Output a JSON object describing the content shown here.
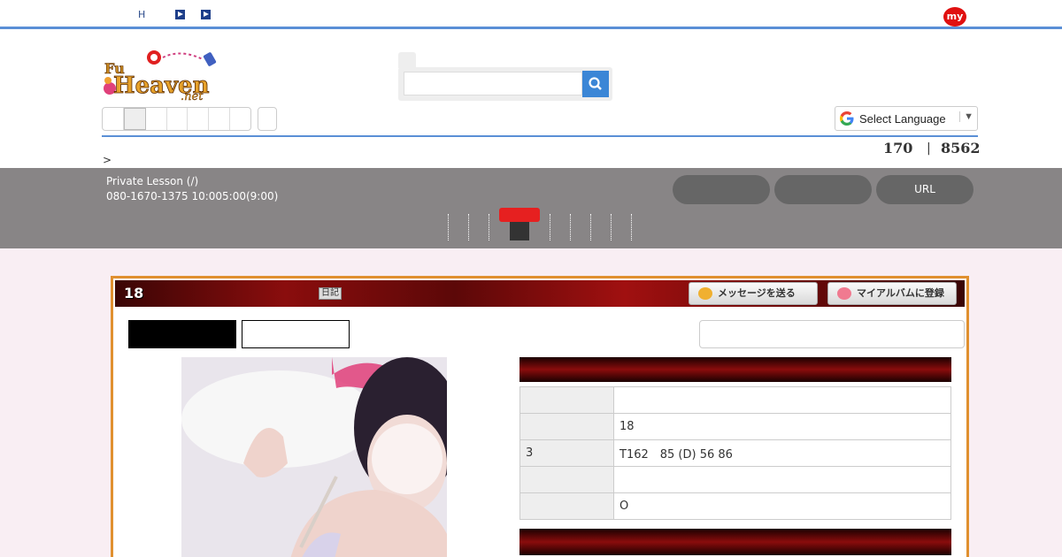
{
  "topbar": {
    "h_label": "H",
    "my_badge": "my"
  },
  "header": {
    "logo_alt": "Fuzoku Heaven net",
    "search": {
      "placeholder": ""
    },
    "language_select": "Select Language",
    "language_arrow": "▼",
    "stats": {
      "left": "170",
      "separator": "|",
      "right": "8562"
    },
    "breadcrumb": ">"
  },
  "shop": {
    "name_line": "Private Lesson (/)",
    "contact_line": "080-1670-1375 10:005:00(9:00)",
    "buttons": [
      "",
      "",
      "URL"
    ]
  },
  "card": {
    "age_label": "18",
    "diary_label": "日記",
    "send_message": "メッセージを送る",
    "register_album": "マイアルバムに登録"
  },
  "profile": {
    "rows": [
      {
        "key": "",
        "value": ""
      },
      {
        "key": "",
        "value": "18"
      },
      {
        "key": "3",
        "value": "T162　85 (D)  56  86"
      },
      {
        "key": "",
        "value": ""
      },
      {
        "key": "",
        "value": "O"
      }
    ]
  },
  "colors": {
    "accent_blue": "#5a8fd6",
    "band_gray": "#888586",
    "card_border": "#e0902f",
    "brand_red": "#e01010"
  }
}
